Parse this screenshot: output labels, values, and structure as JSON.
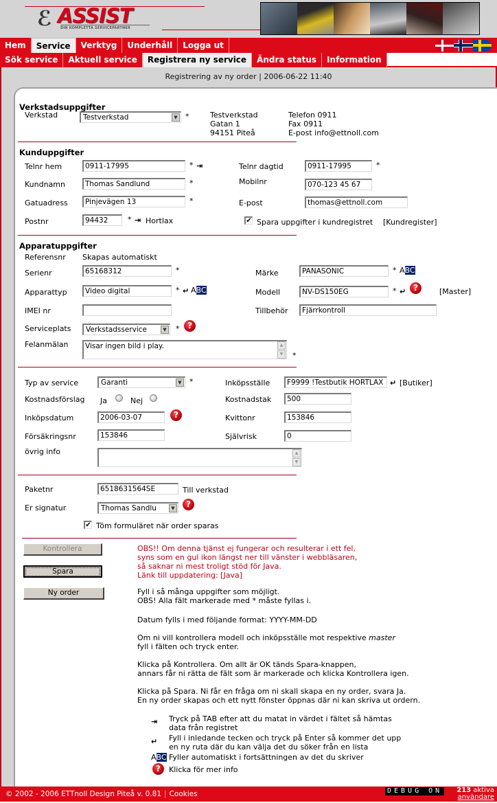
{
  "brand": {
    "logo_text": "ASSIST",
    "logo_tagline": "DIN KOMPLETTA SERVICEPARTNER",
    "accent_color": "#dc0a18"
  },
  "nav_main": [
    {
      "label": "Hem",
      "active": false
    },
    {
      "label": "Service",
      "active": true
    },
    {
      "label": "Verktyg",
      "active": false
    },
    {
      "label": "Underhåll",
      "active": false
    },
    {
      "label": "Logga ut",
      "active": false
    }
  ],
  "languages": [
    "danish-flag",
    "norwegian-flag",
    "swedish-flag"
  ],
  "nav_sub": [
    {
      "label": "Sök service",
      "active": false
    },
    {
      "label": "Aktuell service",
      "active": false
    },
    {
      "label": "Registrera ny service",
      "active": true
    },
    {
      "label": "Ändra status",
      "active": false
    },
    {
      "label": "Information",
      "active": false
    }
  ],
  "page_title": "Registrering av ny order | 2006-06-22 11:40",
  "workshop": {
    "heading": "Verkstadsuppgifter",
    "label": "Verkstad",
    "selected": "Testverkstad",
    "address": [
      "Testverkstad",
      "Gatan 1",
      "94151 Piteå"
    ],
    "contact": [
      "Telefon 0911",
      "Fax 0911",
      "E-post info@ettnoll.com"
    ]
  },
  "customer": {
    "heading": "Kunduppgifter",
    "telnr_hem_label": "Telnr hem",
    "telnr_hem": "0911-17995",
    "telnr_dagtid_label": "Telnr dagtid",
    "telnr_dagtid": "0911-17995",
    "kundnamn_label": "Kundnamn",
    "kundnamn": "Thomas Sandlund",
    "mobilnr_label": "Mobilnr",
    "mobilnr": "070-123 45 67",
    "gatuadress_label": "Gatuadress",
    "gatuadress": "Pinjevägen 13",
    "epost_label": "E-post",
    "epost": "thomas@ettnoll.com",
    "postnr_label": "Postnr",
    "postnr": "94432",
    "ort": "Hortlax",
    "save_label": "Spara uppgifter i kundregistret",
    "save_checked": true,
    "register_link": "[Kundregister]"
  },
  "device": {
    "heading": "Apparatuppgifter",
    "referensnr_label": "Referensnr",
    "referensnr": "Skapas automatiskt",
    "serienr_label": "Serienr",
    "serienr": "65168312",
    "marke_label": "Märke",
    "marke": "PANASONIC",
    "apparattyp_label": "Apparattyp",
    "apparattyp": "Video digital",
    "modell_label": "Modell",
    "modell": "NV-DS150EG",
    "master_link": "[Master]",
    "imei_label": "IMEI nr",
    "imei": "",
    "tillbehor_label": "Tillbehör",
    "tillbehor": "Fjärrkontroll",
    "serviceplats_label": "Serviceplats",
    "serviceplats": "Verkstadsservice",
    "felanmalan_label": "Felanmälan",
    "felanmalan": "Visar ingen bild i play."
  },
  "service": {
    "typ_label": "Typ av service",
    "typ": "Garanti",
    "inkopsstalle_label": "Inköpsställe",
    "inkopsstalle": "F9999 !Testbutik HORTLAX",
    "butiker_link": "[Butiker]",
    "kostnadsforslag_label": "Kostnadsförslag",
    "ja_label": "Ja",
    "nej_label": "Nej",
    "kostnadstak_label": "Kostnadstak",
    "kostnadstak": "500",
    "inkopsdatum_label": "Inköpsdatum",
    "inkopsdatum": "2006-03-07",
    "kvittonr_label": "Kvittonr",
    "kvittonr": "153846",
    "forsakringsnr_label": "Försäkringsnr",
    "forsakringsnr": "153846",
    "sjalvrisk_label": "Självrisk",
    "sjalvrisk": "0",
    "ovrig_label": "övrig info",
    "ovrig": ""
  },
  "shipping": {
    "paketnr_label": "Paketnr",
    "paketnr": "6518631564SE",
    "till_label": "Till verkstad",
    "signatur_label": "Er signatur",
    "signatur": "Thomas Sandlu",
    "clear_label": "Töm formuläret när order sparas",
    "clear_checked": true
  },
  "buttons": {
    "kontrollera": "Kontrollera",
    "spara": "Spara",
    "ny_order": "Ny order"
  },
  "info": {
    "warning": [
      "OBS!! Om denna tjänst ej fungerar och resulterar i ett fel,",
      "syns som en gul ikon längst ner till vänster i webbläsaren,",
      "så saknar ni mest troligt stöd för Java.",
      "Länk till uppdatering: [Java]"
    ],
    "p1": [
      "Fyll i så många uppgifter som möjligt.",
      "OBS! Alla fält markerade med * måste fyllas i."
    ],
    "p2": "Datum fylls i med följande format: YYYY-MM-DD",
    "p3a": "Om ni vill kontrollera modell och inköpsställe mot respektive ",
    "p3em": "master",
    "p3b": "fyll i fälten och tryck enter.",
    "p4": [
      "Klicka på Kontrollera. Om allt är OK tänds Spara-knappen,",
      "annars får ni rätta de fält som är markerade och klicka Kontrollera igen."
    ],
    "p5": [
      "Klicka på Spara. Ni får en fråga om ni skall skapa en ny order, svara Ja.",
      "En ny order skapas och ett nytt fönster öppnas där ni kan skriva ut ordern."
    ],
    "legend_tab": [
      "Tryck på TAB efter att du matat in värdet i fältet så hämtas",
      "data från registret"
    ],
    "legend_enter": [
      "Fyll i inledande tecken och tryck på Enter så kommer det upp",
      "en ny ruta där du kan välja det du söker från en lista"
    ],
    "legend_abc": "Fyller automatiskt i fortsättningen av det du skriver",
    "legend_help": "Klicka för mer info"
  },
  "symbols": {
    "star": "*",
    "tab": "⇥",
    "enter": "↵",
    "abc_a": "A",
    "abc_bc": "BC",
    "help": "?",
    "check": "✔",
    "arrow": "▼",
    "up": "▲"
  },
  "footer": {
    "copyright": "© 2002 - 2006 ETTnoll Design Piteå  v. 0.81",
    "cookies": "Cookies",
    "debug": "DEBUG ON",
    "users_count": "213",
    "users_label1": "aktiva",
    "users_label2": "användare"
  }
}
